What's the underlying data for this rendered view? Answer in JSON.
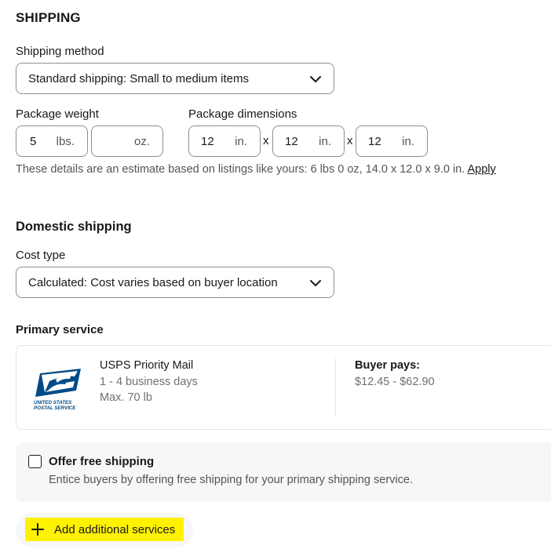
{
  "shipping": {
    "title": "SHIPPING",
    "method_label": "Shipping method",
    "method_value": "Standard shipping: Small to medium items",
    "weight_label": "Package weight",
    "weight_lbs": "5",
    "weight_lbs_unit": "lbs.",
    "weight_oz": "",
    "weight_oz_unit": "oz.",
    "dimensions_label": "Package dimensions",
    "dim_length": "12",
    "dim_width": "12",
    "dim_height": "12",
    "dim_unit": "in.",
    "dim_separator": "x",
    "estimate_hint": "These details are an estimate based on listings like yours: 6 lbs 0 oz, 14.0 x 12.0 x 9.0 in.",
    "apply_link": "Apply"
  },
  "domestic": {
    "title": "Domestic shipping",
    "cost_type_label": "Cost type",
    "cost_type_value": "Calculated: Cost varies based on buyer location",
    "primary_service_label": "Primary service",
    "service": {
      "name": "USPS Priority Mail",
      "delivery_time": "1 - 4 business days",
      "max_weight": "Max. 70 lb",
      "buyer_pays_label": "Buyer pays:",
      "buyer_pays_range": "$12.45 - $62.90",
      "logo_text_line1": "UNITED STATES",
      "logo_text_line2": "POSTAL SERVICE"
    },
    "free_shipping": {
      "label": "Offer free shipping",
      "description": "Entice buyers by offering free shipping for your primary shipping service.",
      "checked": false
    },
    "add_services_label": "Add additional services"
  },
  "colors": {
    "highlight": "#fff200",
    "usps_blue": "#004b87",
    "border": "#8f8f8f",
    "muted_text": "#707070"
  }
}
